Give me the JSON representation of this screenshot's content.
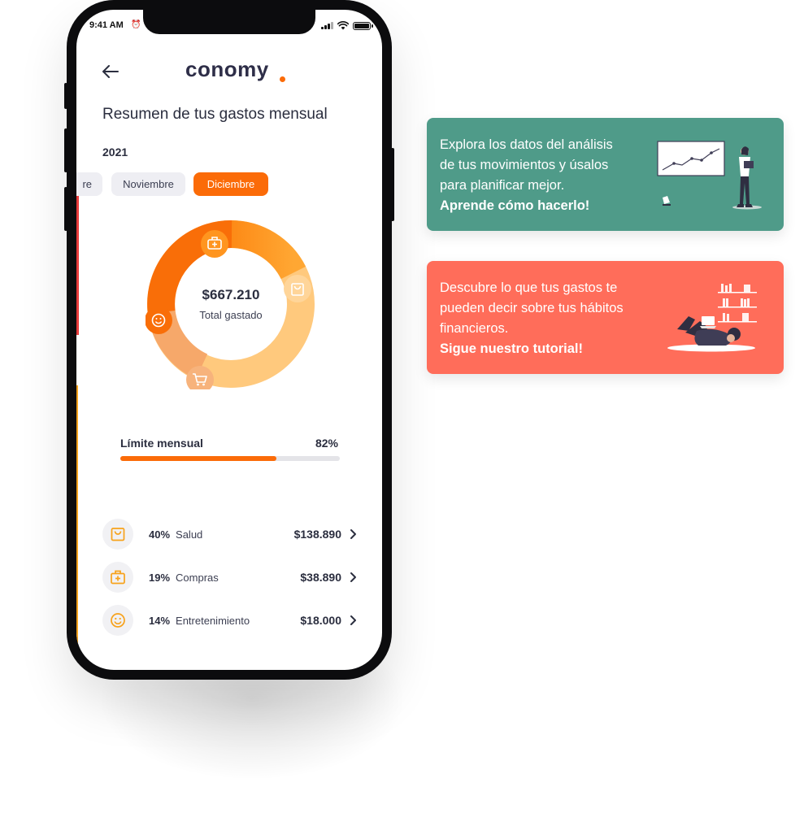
{
  "status_bar": {
    "time": "9:41 AM"
  },
  "app": {
    "logo_text": "conomy",
    "brand_color": "#fb6b08"
  },
  "header": {
    "title": "Resumen de tus gastos mensual",
    "year": "2021"
  },
  "months": {
    "items": [
      {
        "label": "re",
        "selected": false
      },
      {
        "label": "Noviembre",
        "selected": false
      },
      {
        "label": "Diciembre",
        "selected": true
      }
    ]
  },
  "summary": {
    "total_value": "$667.210",
    "total_label": "Total gastado"
  },
  "donut": {
    "segments": [
      {
        "icon": "medkit-icon",
        "color": "#ff9f2b"
      },
      {
        "icon": "shopping-bag-icon",
        "color": "#ffc97d"
      },
      {
        "icon": "shopping-cart-icon",
        "color": "#f6a86a"
      },
      {
        "icon": "smiley-icon",
        "color": "#f96e08"
      }
    ]
  },
  "limit": {
    "label": "Límite mensual",
    "percent_text": "82%",
    "fill_fraction": 0.71
  },
  "categories": [
    {
      "percent": "40%",
      "name": "Salud",
      "amount": "$138.890",
      "icon": "shopping-bag-icon"
    },
    {
      "percent": "19%",
      "name": "Compras",
      "amount": "$38.890",
      "icon": "medkit-icon"
    },
    {
      "percent": "14%",
      "name": "Entretenimiento",
      "amount": "$18.000",
      "icon": "smiley-icon"
    }
  ],
  "cards": [
    {
      "lines": [
        "Explora los datos del análisis",
        "de tus movimientos y úsalos",
        "para planificar mejor."
      ],
      "cta": "Aprende cómo hacerlo!",
      "color": "#4f9b89",
      "illustration": "chart-presentation-illustration"
    },
    {
      "lines": [
        "Descubre lo que tus gastos te",
        "pueden decir sobre tus hábitos",
        "financieros."
      ],
      "cta": "Sigue nuestro tutorial!",
      "color": "#ff6d5a",
      "illustration": "reading-laptop-illustration"
    }
  ]
}
